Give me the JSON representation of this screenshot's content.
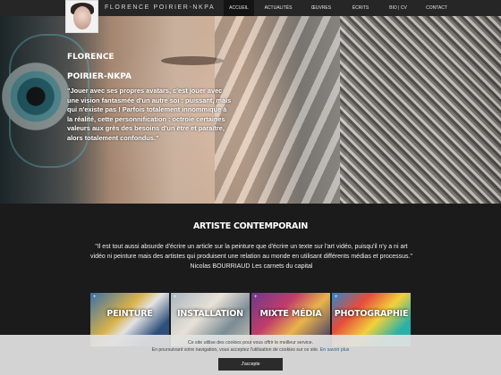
{
  "site": {
    "name": "FLORENCE POIRIER-NKPA"
  },
  "nav": {
    "items": [
      {
        "label": "ACCUEIL",
        "active": true
      },
      {
        "label": "ACTUALITÉS",
        "active": false
      },
      {
        "label": "ŒUVRES",
        "active": false
      },
      {
        "label": "ÉCRITS",
        "active": false
      },
      {
        "label": "BIO | CV",
        "active": false
      },
      {
        "label": "CONTACT",
        "active": false
      }
    ]
  },
  "hero": {
    "name_line1": "Florence",
    "name_line2": "Poirier-Nkpa",
    "quote": "\"Jouer avec ses propres avatars, c'est jouer avec une vision fantasmée d'un autre soi : puissant, mais qui n'existe pas ! Parfois totalement innommique à la réalité, cette personnification : octroie certaines valeurs aux grès des besoins d'un être et paraître, alors totalement confondus.\""
  },
  "section": {
    "title": "Artiste contemporain",
    "quote": "\"Il est tout aussi absurde d'écrire un article sur la peinture que d'écrire un texte sur l'art vidéo, puisqu'il n'y a ni art vidéo ni peinture mais des artistes qui produisent une relation au monde en utilisant différents médias et processus.\"",
    "quote_source": "Nicolas BOURRIAUD Les carnets du capital"
  },
  "categories": [
    {
      "label": "Peinture"
    },
    {
      "label": "Installation"
    },
    {
      "label": "Mixte Média"
    },
    {
      "label": "Photographie"
    }
  ],
  "cookie": {
    "line1": "Ce site utilise des cookies pour vous offrir le meilleur service.",
    "line2": "En poursuivant votre navigation, vous acceptez l'utilisation de cookies sur ce site.",
    "more_link": "En savoir plus",
    "accept_label": "J'accepte"
  }
}
